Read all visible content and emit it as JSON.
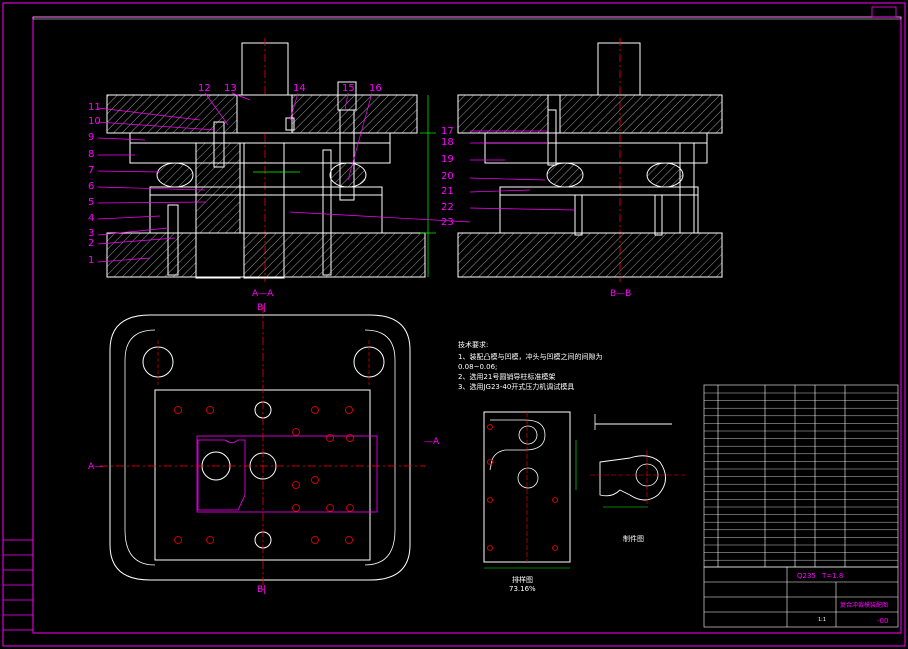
{
  "drawing": {
    "section_aa": "A—A",
    "section_bb": "B—B",
    "cut_b_top": "B|",
    "cut_b_bottom": "B|",
    "cut_a_left": "A—",
    "cut_a_right": "—A",
    "part_numbers_left": [
      "1",
      "2",
      "3",
      "4",
      "5",
      "6",
      "7",
      "8",
      "9",
      "10",
      "11"
    ],
    "part_numbers_top": [
      "12",
      "13",
      "14",
      "15",
      "16"
    ],
    "part_numbers_right": [
      "17",
      "18",
      "19",
      "20",
      "21",
      "22",
      "23"
    ],
    "tech_req_title": "技术要求:",
    "tech_req_lines": [
      "1、装配凸模与凹模，冲头与凹模之间的间隙为",
      "0.08~0.06;",
      "2、选用21号圆销导柱标准模架",
      "3、选用JG23-40开式压力机调试模具"
    ],
    "blank_view_label": "排样图",
    "blank_scale": "73.16%",
    "part_view_label": "制件图",
    "title_block": {
      "material": "Q235",
      "thickness": "T=1.8",
      "drawing_name": "复合冲裁模装配图",
      "scale": "1:1",
      "drawing_no": "-00"
    }
  }
}
